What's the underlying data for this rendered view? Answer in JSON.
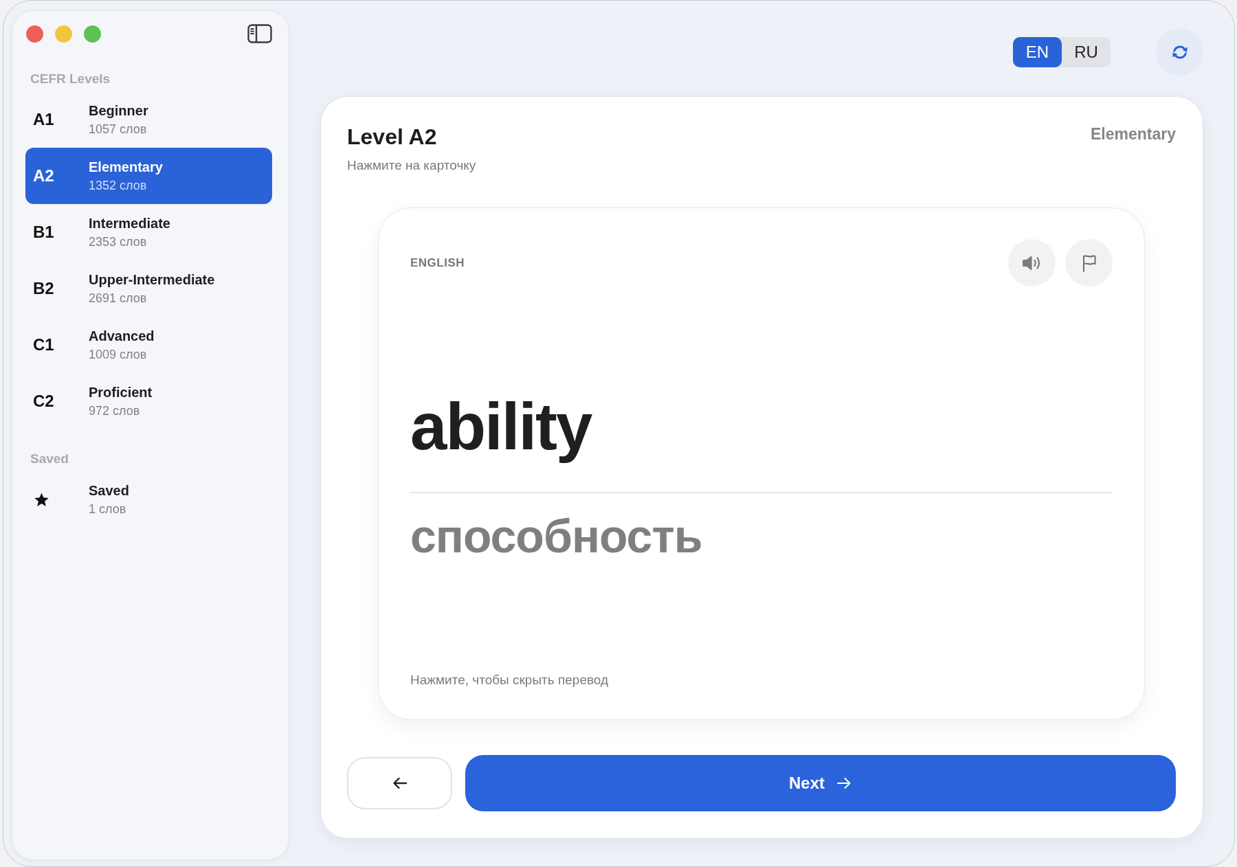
{
  "sidebar": {
    "sections": [
      {
        "title": "CEFR Levels",
        "items": [
          {
            "kind": "level",
            "code": "A1",
            "title": "Beginner",
            "count": "1057 слов",
            "selected": false
          },
          {
            "kind": "level",
            "code": "A2",
            "title": "Elementary",
            "count": "1352 слов",
            "selected": true
          },
          {
            "kind": "level",
            "code": "B1",
            "title": "Intermediate",
            "count": "2353 слов",
            "selected": false
          },
          {
            "kind": "level",
            "code": "B2",
            "title": "Upper-Intermediate",
            "count": "2691 слов",
            "selected": false
          },
          {
            "kind": "level",
            "code": "C1",
            "title": "Advanced",
            "count": "1009 слов",
            "selected": false
          },
          {
            "kind": "level",
            "code": "C2",
            "title": "Proficient",
            "count": "972 слов",
            "selected": false
          }
        ]
      },
      {
        "title": "Saved",
        "items": [
          {
            "kind": "saved",
            "title": "Saved",
            "count": "1 слов",
            "selected": false
          }
        ]
      }
    ]
  },
  "language_toggle": {
    "options": [
      {
        "label": "EN",
        "selected": true
      },
      {
        "label": "RU",
        "selected": false
      }
    ]
  },
  "panel": {
    "title": "Level A2",
    "subtitle": "Нажмите на карточку",
    "level_name": "Elementary",
    "card": {
      "language": "ENGLISH",
      "word": "ability",
      "translation": "способность",
      "hint": "Нажмите, чтобы скрыть перевод"
    },
    "next_button": {
      "label": "Next"
    }
  }
}
